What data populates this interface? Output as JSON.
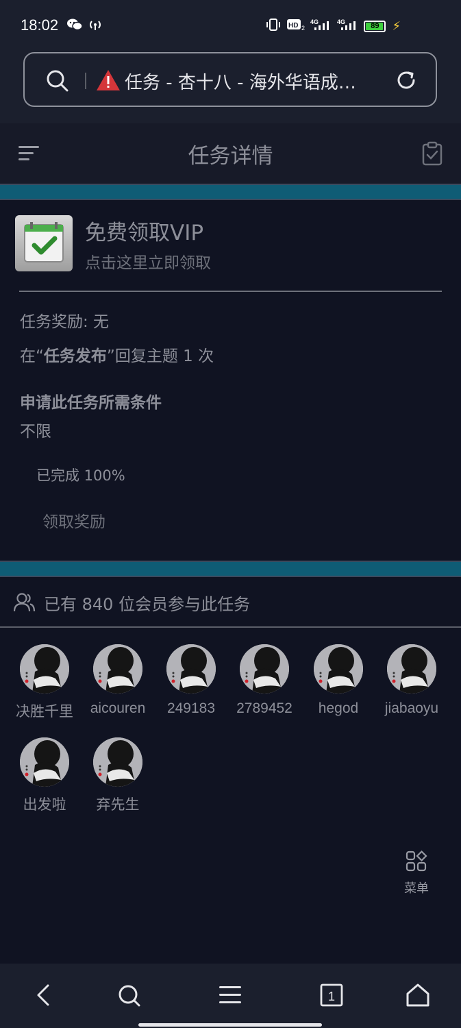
{
  "status_bar": {
    "time": "18:02",
    "battery": "89",
    "icons": [
      "wechat-icon",
      "hotspot-icon",
      "vibrate-icon",
      "hd-icon",
      "signal-4g-icon",
      "signal-4g-icon",
      "battery-icon",
      "charging-bolt-icon"
    ]
  },
  "browser": {
    "address_text": "任务 - 杏十八 - 海外华语成…"
  },
  "header": {
    "title": "任务详情"
  },
  "vip": {
    "title": "免费领取VIP",
    "subtitle": "点击这里立即领取"
  },
  "task": {
    "reward": "任务奖励: 无",
    "instruction_prefix": "在“",
    "instruction_forum": "任务发布",
    "instruction_suffix": "”回复主题 1 次",
    "conditions_title": "申请此任务所需条件",
    "conditions_value": "不限",
    "progress": "已完成 100%",
    "progress_value": 1.0,
    "claim_label": "领取奖励"
  },
  "participants": {
    "summary": "已有 840 位会员参与此任务",
    "members": [
      {
        "name": "决胜千里"
      },
      {
        "name": "aicouren"
      },
      {
        "name": "249183"
      },
      {
        "name": "2789452"
      },
      {
        "name": "hegod"
      },
      {
        "name": "jiabaoyu"
      },
      {
        "name": "出发啦"
      },
      {
        "name": "弃先生"
      }
    ]
  },
  "float_menu": {
    "label": "菜单"
  },
  "colors": {
    "background": "#101322",
    "teal_band": "#0f5c75",
    "text": "#8d8f99",
    "warning": "#d4363a",
    "battery": "#3ecf3e"
  }
}
